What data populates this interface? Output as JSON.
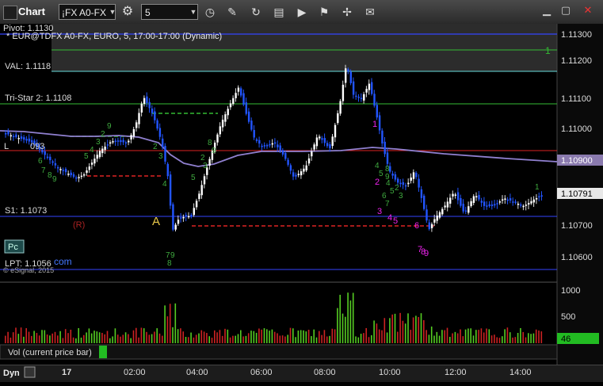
{
  "window": {
    "title": "Chart",
    "symbol": "¡FX A0-FX",
    "interval": "5"
  },
  "header": {
    "line1": "Pivot: 1.1130",
    "line2": "* EUR@TDFX A0-FX, EURO, 5, 17:00-17:00 (Dynamic)"
  },
  "price_axis": {
    "ticks": [
      "1.11300",
      "1.11200",
      "1.11100",
      "1.11000",
      "1.10700",
      "1.10600"
    ],
    "current_badge": "1.10791",
    "ma_badge": "1.10900"
  },
  "level_labels": {
    "val": "VAL: 1.1118",
    "tristar": "Tri-Star 2: 1.1108",
    "left_mid": "L",
    "left_mid_tail": "093",
    "s1": "S1: 1.1073",
    "lpt": "LPT: 1.1056",
    "r_marker": "(R)",
    "a_marker": "A",
    "pc": "Pc",
    "com": "com",
    "esignal": "© eSignal, 2015",
    "line_tag_1": "1"
  },
  "volume": {
    "label": "Vol (current price bar)",
    "ticks": [
      "1000",
      "500"
    ],
    "badge": "46"
  },
  "time_axis": {
    "mode": "Dyn",
    "labels": [
      "17",
      "02:00",
      "04:00",
      "06:00",
      "08:00",
      "10:00",
      "12:00",
      "14:00"
    ]
  },
  "annotations": {
    "green_counts": [
      "9",
      "2",
      "3",
      "4",
      "5",
      "6",
      "7",
      "8",
      "9",
      "2",
      "3",
      "4",
      "5",
      "8",
      "9",
      "2",
      "3",
      "4",
      "5",
      "6",
      "7",
      "8",
      "9",
      "1",
      "2",
      "3",
      "4",
      "5"
    ],
    "magenta_counts": [
      "1",
      "2",
      "3",
      "4",
      "5",
      "6",
      "7",
      "8",
      "9"
    ],
    "lower_green": [
      "7",
      "9",
      "8"
    ]
  },
  "colors": {
    "candle_up": "#ffffff",
    "candle_down": "#2255ff",
    "ma": "#9080d0",
    "pivot": "#3344ff",
    "val": "#66dddd",
    "green_line": "#33bb33",
    "red_line": "#dd2222",
    "vol_up": "#55cc22",
    "vol_down": "#cc2222"
  }
}
